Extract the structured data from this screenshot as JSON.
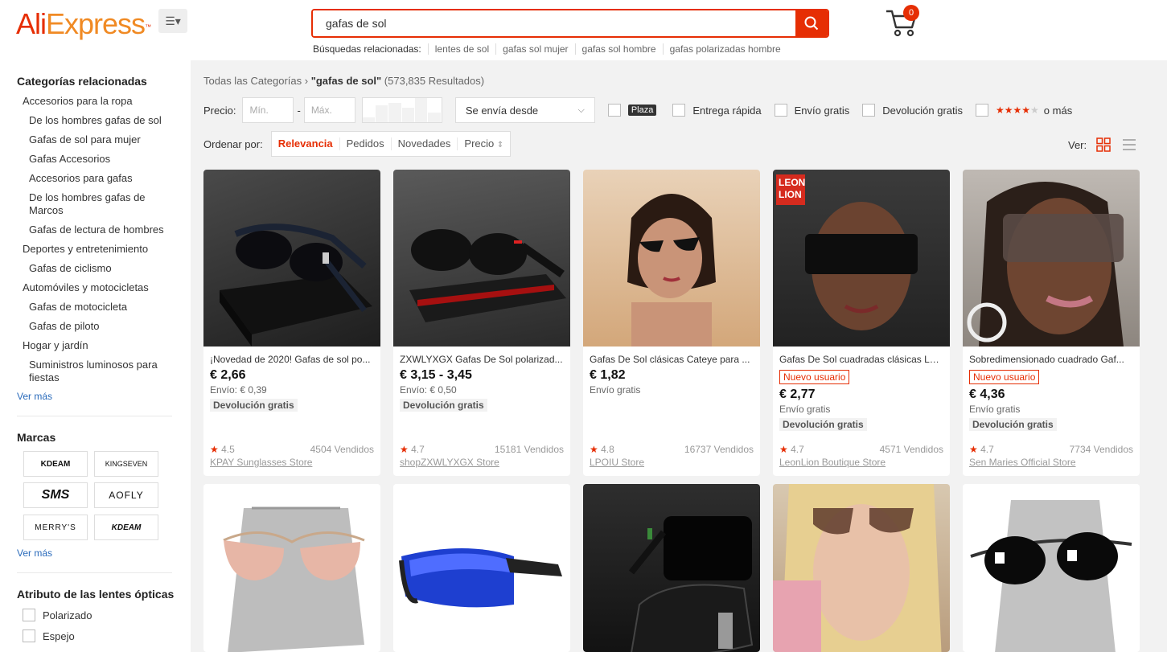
{
  "header": {
    "logo_main": "AliExpress",
    "search_value": "gafas de sol",
    "related_label": "Búsquedas relacionadas:",
    "related": [
      "lentes de sol",
      "gafas sol mujer",
      "gafas sol hombre",
      "gafas polarizadas hombre"
    ],
    "cart_count": "0"
  },
  "sidebar": {
    "categories_title": "Categorías relacionadas",
    "categories": [
      {
        "label": "Accesorios para la ropa",
        "level": 1
      },
      {
        "label": "De los hombres gafas de sol",
        "level": 2
      },
      {
        "label": "Gafas de sol para mujer",
        "level": 2
      },
      {
        "label": "Gafas Accesorios",
        "level": 2
      },
      {
        "label": "Accesorios para gafas",
        "level": 2
      },
      {
        "label": "De los hombres gafas de Marcos",
        "level": 2
      },
      {
        "label": "Gafas de lectura de hombres",
        "level": 2
      },
      {
        "label": "Deportes y entretenimiento",
        "level": 1
      },
      {
        "label": "Gafas de ciclismo",
        "level": 2
      },
      {
        "label": "Automóviles y motocicletas",
        "level": 1
      },
      {
        "label": "Gafas de motocicleta",
        "level": 2
      },
      {
        "label": "Gafas de piloto",
        "level": 2
      },
      {
        "label": "Hogar y jardín",
        "level": 1
      },
      {
        "label": "Suministros luminosos para fiestas",
        "level": 2
      }
    ],
    "see_more": "Ver más",
    "brands_title": "Marcas",
    "brands": [
      "KDEAM",
      "KINGSEVEN",
      "SMS",
      "AOFLY",
      "MERRY'S",
      "KDEAM"
    ],
    "brands_more": "Ver más",
    "attr_title": "Atributo de las lentes ópticas",
    "attrs": [
      "Polarizado",
      "Espejo"
    ]
  },
  "main": {
    "breadcrumb_root": "Todas las Categorías",
    "breadcrumb_query": "\"gafas de sol\"",
    "breadcrumb_count": "(573,835 Resultados)",
    "price_label": "Precio:",
    "price_min_placeholder": "Mín.",
    "price_max_placeholder": "Máx.",
    "ship_from": "Se envía desde",
    "plaza": "Plaza",
    "fast_delivery": "Entrega rápida",
    "free_shipping": "Envío gratis",
    "free_return": "Devolución gratis",
    "rating_suffix": "o más",
    "sort_label": "Ordenar por:",
    "sort_options": [
      "Relevancia",
      "Pedidos",
      "Novedades",
      "Precio"
    ],
    "view_label": "Ver:"
  },
  "products": [
    {
      "title": "¡Novedad de 2020! Gafas de sol po...",
      "new_user": "",
      "price": "€ 2,66",
      "ship": "Envío: € 0,39",
      "ret": "Devolución gratis",
      "rating": "4.5",
      "sold": "4504 Vendidos",
      "store": "KPAY Sunglasses Store"
    },
    {
      "title": "ZXWLYXGX Gafas De Sol polarizad...",
      "new_user": "",
      "price": "€ 3,15 - 3,45",
      "ship": "Envío: € 0,50",
      "ret": "Devolución gratis",
      "rating": "4.7",
      "sold": "15181 Vendidos",
      "store": "shopZXWLYXGX Store"
    },
    {
      "title": "Gafas De Sol clásicas Cateye para ...",
      "new_user": "",
      "price": "€ 1,82",
      "ship": "Envío gratis",
      "ret": "",
      "rating": "4.8",
      "sold": "16737 Vendidos",
      "store": "LPOIU Store"
    },
    {
      "title": "Gafas De Sol cuadradas clásicas LE...",
      "new_user": "Nuevo usuario",
      "price": "€ 2,77",
      "ship": "Envío gratis",
      "ret": "Devolución gratis",
      "rating": "4.7",
      "sold": "4571 Vendidos",
      "store": "LeonLion Boutique Store"
    },
    {
      "title": "Sobredimensionado cuadrado Gaf...",
      "new_user": "Nuevo usuario",
      "price": "€ 4,36",
      "ship": "Envío gratis",
      "ret": "Devolución gratis",
      "rating": "4.7",
      "sold": "7734 Vendidos",
      "store": "Sen Maries Official Store"
    }
  ],
  "image_labels": {
    "leonlion_line1": "LEON",
    "leonlion_line2": "LION"
  },
  "colors": {
    "accent": "#e62e04",
    "link": "#2a6bbb",
    "bg": "#f2f2f2"
  }
}
